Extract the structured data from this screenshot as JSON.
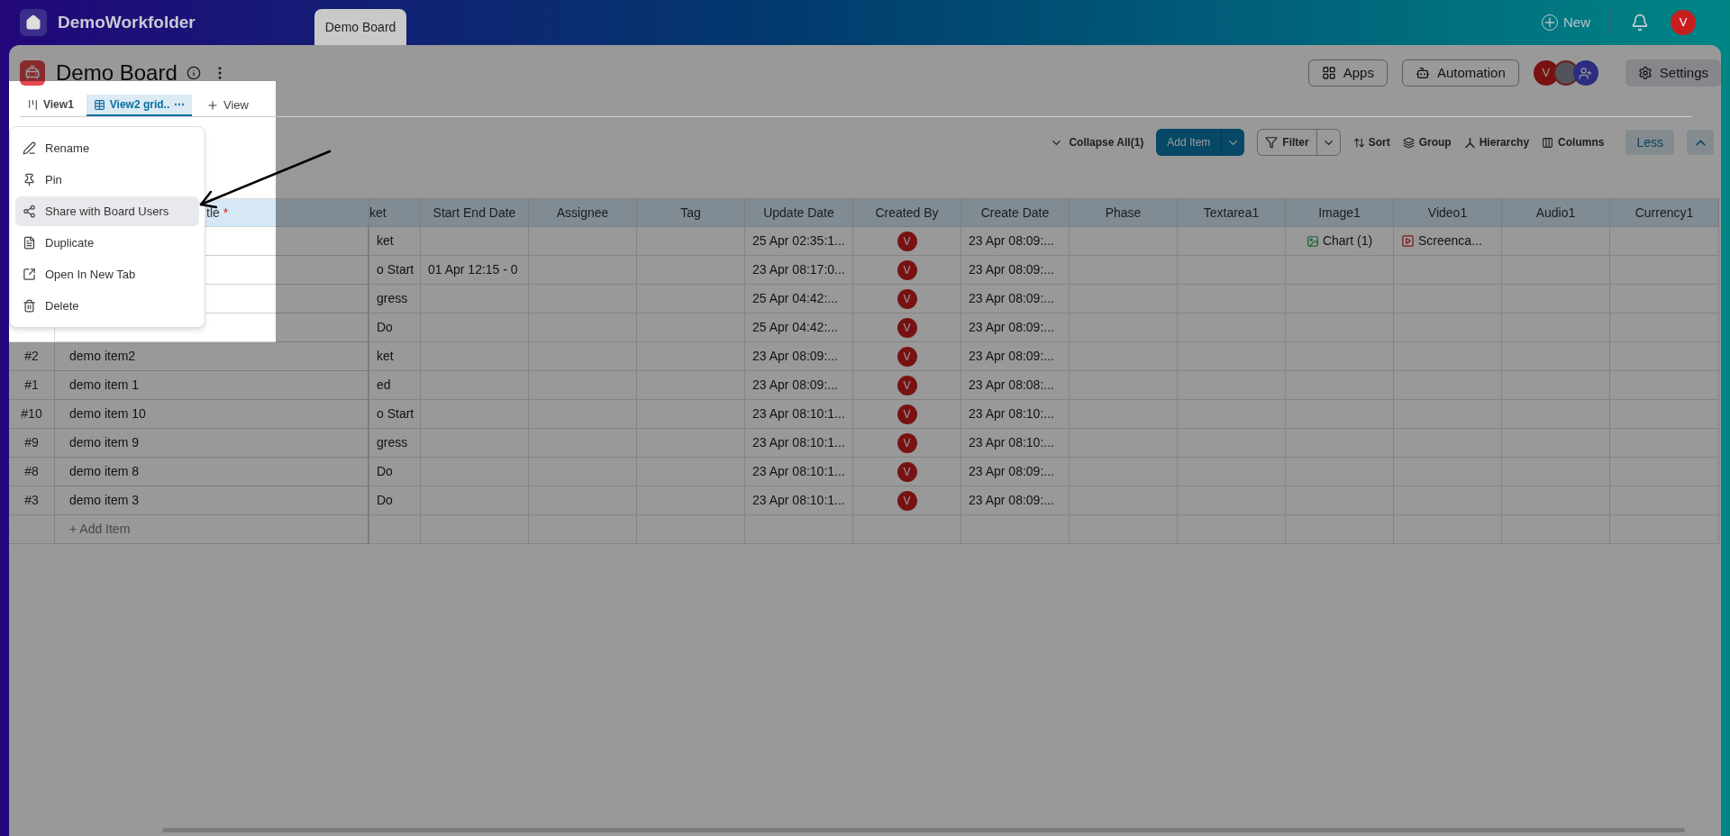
{
  "top_bar": {
    "workspace": "DemoWorkfolder",
    "tabs": [
      {
        "label": "Demo Board",
        "selected": true
      }
    ],
    "new_button": "New",
    "avatar": "V"
  },
  "board": {
    "title": "Demo Board",
    "buttons": [
      {
        "kind": "apps",
        "label": "Apps"
      },
      {
        "kind": "automation",
        "label": "Automation"
      }
    ],
    "member_avatar": "V",
    "settings": "Settings"
  },
  "view_tabs": [
    {
      "kind": "kanban",
      "label": "View1",
      "selected": false
    },
    {
      "kind": "grid",
      "label": "View2 grid..",
      "more": "⋯",
      "selected": true
    }
  ],
  "add_view": "View",
  "view_menu": [
    {
      "kind": "rename",
      "label": "Rename",
      "selected": false
    },
    {
      "kind": "pin",
      "label": "Pin",
      "selected": false
    },
    {
      "kind": "share",
      "label": "Share with Board Users",
      "selected": true
    },
    {
      "kind": "duplicate",
      "label": "Duplicate",
      "selected": false
    },
    {
      "kind": "open",
      "label": "Open In New Tab",
      "selected": false
    },
    {
      "kind": "delete",
      "label": "Delete",
      "selected": false
    }
  ],
  "toolbar": {
    "collapse": "Collapse All(1)",
    "add_item": "Add Item",
    "filter": "Filter",
    "sort": "Sort",
    "group": "Group",
    "hierarchy": "Hierarchy",
    "columns": "Columns",
    "less": "Less"
  },
  "table": {
    "title_column": {
      "label": "tle",
      "required_mark": "*"
    },
    "columns": [
      {
        "kind": "text",
        "label": "ket"
      },
      {
        "kind": "text",
        "label": "Start End Date"
      },
      {
        "kind": "text",
        "label": "Assignee"
      },
      {
        "kind": "text",
        "label": "Tag"
      },
      {
        "kind": "text",
        "label": "Update Date"
      },
      {
        "kind": "avatar",
        "label": "Created By"
      },
      {
        "kind": "text",
        "label": "Create Date"
      },
      {
        "kind": "text",
        "label": "Phase"
      },
      {
        "kind": "text",
        "label": "Textarea1"
      },
      {
        "kind": "image",
        "label": "Image1"
      },
      {
        "kind": "video",
        "label": "Video1"
      },
      {
        "kind": "text",
        "label": "Audio1"
      },
      {
        "kind": "text",
        "label": "Currency1"
      }
    ],
    "rows": [
      {
        "cells": [
          "ket",
          null,
          null,
          null,
          "25 Apr 02:35:1...",
          "V",
          "23 Apr 08:09:...",
          null,
          null,
          "Chart (1)",
          "Screenca...",
          null,
          null
        ]
      },
      {
        "cells": [
          "o Start",
          "01 Apr 12:15  -  0",
          null,
          null,
          "23 Apr 08:17:0...",
          "V",
          "23 Apr 08:09:...",
          null,
          null,
          null,
          null,
          null,
          null
        ]
      },
      {
        "cells": [
          "gress",
          null,
          null,
          null,
          "25 Apr 04:42:...",
          "V",
          "23 Apr 08:09:...",
          null,
          null,
          null,
          null,
          null,
          null
        ]
      },
      {
        "cells": [
          "Do",
          null,
          null,
          null,
          "25 Apr 04:42:...",
          "V",
          "23 Apr 08:09:...",
          null,
          null,
          null,
          null,
          null,
          null
        ]
      },
      {
        "id": "#2",
        "title": "demo item2",
        "cells": [
          "ket",
          null,
          null,
          null,
          "23 Apr 08:09:...",
          "V",
          "23 Apr 08:09:...",
          null,
          null,
          null,
          null,
          null,
          null
        ]
      },
      {
        "id": "#1",
        "title": "demo item 1",
        "cells": [
          "ed",
          null,
          null,
          null,
          "23 Apr 08:09:...",
          "V",
          "23 Apr 08:08:...",
          null,
          null,
          null,
          null,
          null,
          null
        ]
      },
      {
        "id": "#10",
        "title": "demo item 10",
        "cells": [
          "o Start",
          null,
          null,
          null,
          "23 Apr 08:10:1...",
          "V",
          "23 Apr 08:10:...",
          null,
          null,
          null,
          null,
          null,
          null
        ]
      },
      {
        "id": "#9",
        "title": "demo item 9",
        "cells": [
          "gress",
          null,
          null,
          null,
          "23 Apr 08:10:1...",
          "V",
          "23 Apr 08:10:...",
          null,
          null,
          null,
          null,
          null,
          null
        ]
      },
      {
        "id": "#8",
        "title": "demo item 8",
        "cells": [
          "Do",
          null,
          null,
          null,
          "23 Apr 08:10:1...",
          "V",
          "23 Apr 08:09:...",
          null,
          null,
          null,
          null,
          null,
          null
        ]
      },
      {
        "id": "#3",
        "title": "demo item 3",
        "cells": [
          "Do",
          null,
          null,
          null,
          "23 Apr 08:10:1...",
          "V",
          "23 Apr 08:09:...",
          null,
          null,
          null,
          null,
          null,
          null
        ]
      }
    ],
    "add_row": "+ Add Item"
  }
}
